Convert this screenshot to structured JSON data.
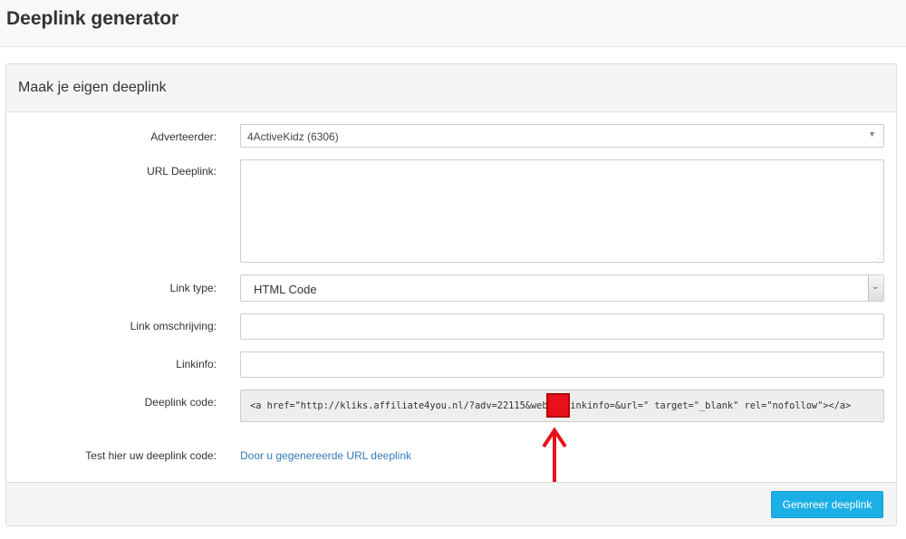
{
  "page": {
    "title": "Deeplink generator"
  },
  "panel": {
    "heading": "Maak je eigen deeplink"
  },
  "form": {
    "advertiser_label": "Adverteerder:",
    "advertiser_value": "4ActiveKidz (6306)",
    "url_label": "URL Deeplink:",
    "url_value": "",
    "link_type_label": "Link type:",
    "link_type_value": "HTML Code",
    "description_label": "Link omschrijving:",
    "description_value": "",
    "linkinfo_label": "Linkinfo:",
    "linkinfo_value": "",
    "code_label": "Deeplink code:",
    "code_value": "<a href=\"http://kliks.affiliate4you.nl/?adv=22115&web=    &linkinfo=&url=\" target=\"_blank\" rel=\"nofollow\"></a>",
    "test_label": "Test hier uw deeplink code:",
    "test_link": "Door u gegenereerde URL deeplink"
  },
  "footer": {
    "button_label": "Genereer deeplink"
  },
  "colors": {
    "accent": "#1cafe6",
    "link": "#337ab7",
    "highlight": "#e8101a"
  },
  "icons": {
    "select_arrow": "chevron-down-icon",
    "annotation": "arrow-up-icon"
  }
}
